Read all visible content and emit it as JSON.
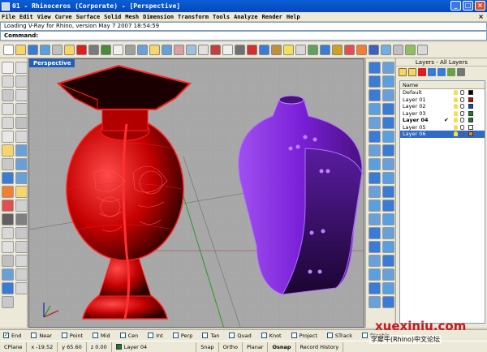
{
  "window": {
    "title": "01 - Rhinoceros (Corporate) - [Perspective]",
    "buttons": [
      "_",
      "□",
      "×"
    ]
  },
  "menu": {
    "items": [
      "File",
      "Edit",
      "View",
      "Curve",
      "Surface",
      "Solid",
      "Mesh",
      "Dimension",
      "Transform",
      "Tools",
      "Analyze",
      "Render",
      "Help"
    ],
    "close": "×"
  },
  "command": {
    "history": "Loading V-Ray for Rhino, version May  7 2007  18:54:59",
    "prompt": "Command:"
  },
  "viewport": {
    "tab_label": "Perspective"
  },
  "layers_panel": {
    "title": "Layers - All Layers",
    "column_name": "Name",
    "layers": [
      {
        "name": "Default",
        "color": "#000000"
      },
      {
        "name": "Layer 01",
        "color": "#d40000"
      },
      {
        "name": "Layer 02",
        "color": "#0050c8"
      },
      {
        "name": "Layer 03",
        "color": "#1a7c24"
      },
      {
        "name": "Layer 04",
        "color": "#1a7c24",
        "current": true,
        "check": "✔"
      },
      {
        "name": "Layer 05",
        "color": "#ffffff"
      },
      {
        "name": "Layer 06",
        "color": "#d88a2a",
        "selected": true
      }
    ]
  },
  "osnap": {
    "items": [
      {
        "label": "End",
        "checked": true
      },
      {
        "label": "Near",
        "checked": false
      },
      {
        "label": "Point",
        "checked": false
      },
      {
        "label": "Mid",
        "checked": false
      },
      {
        "label": "Cen",
        "checked": false
      },
      {
        "label": "Int",
        "checked": false
      },
      {
        "label": "Perp",
        "checked": false
      },
      {
        "label": "Tan",
        "checked": false
      },
      {
        "label": "Quad",
        "checked": false
      },
      {
        "label": "Knot",
        "checked": false
      },
      {
        "label": "Project",
        "checked": false
      },
      {
        "label": "STrack",
        "checked": false
      },
      {
        "label": "Disable",
        "checked": false
      }
    ]
  },
  "status": {
    "cplane": "CPlane",
    "x": "x -19.52",
    "y": "y 65.60",
    "z": "z 0.00",
    "layer": "Layer 04",
    "snap": "Snap",
    "ortho": "Ortho",
    "planar": "Planar",
    "osnap": "Osnap",
    "record_history": "Record History"
  },
  "watermark": {
    "site": "xuexiniu.com",
    "caption": "学犀牛(Rhino)中文论坛"
  },
  "colors": {
    "titlebar": "#0a5fd8",
    "red_model": "#d40000",
    "purple_model": "#8a2ce8",
    "selection": "#316ac5"
  }
}
